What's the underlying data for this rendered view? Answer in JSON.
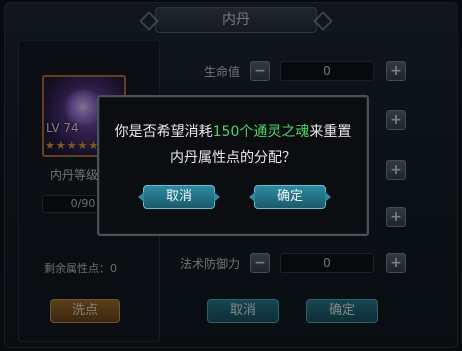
{
  "panel": {
    "title": "内丹",
    "portrait_level": "LV 74",
    "stars": "★★★★★",
    "level_label": "内丹等级",
    "progress_text": "0/90",
    "progress_fraction": 0,
    "remaining_points": "剩余属性点：0",
    "wash_button": "洗点",
    "cancel_button": "取消",
    "confirm_button": "确定"
  },
  "attributes": [
    {
      "label": "生命值",
      "value": "0"
    },
    {
      "label": "法术防御力",
      "value": "0"
    }
  ],
  "icons": {
    "minus": "−",
    "plus": "+"
  },
  "dialog": {
    "msg_prefix": "你是否希望消耗",
    "msg_highlight": "150个通灵之魂",
    "msg_suffix": "来重置内丹属性点的分配？",
    "cancel": "取消",
    "confirm": "确定",
    "highlight_color": "#4fd36b"
  }
}
